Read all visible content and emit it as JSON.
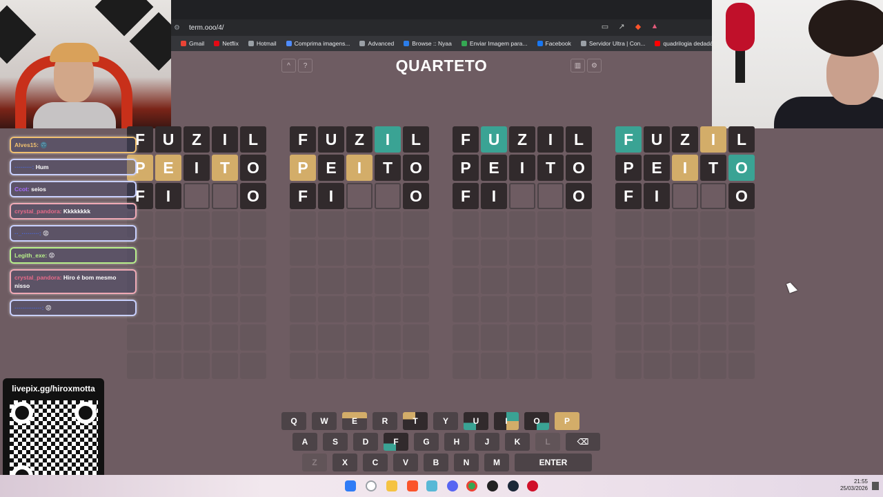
{
  "browser": {
    "url": "term.ooo/4/",
    "bookmarks": [
      "Gmail",
      "Netflix",
      "Hotmail",
      "Comprima imagens...",
      "Advanced",
      "Browse :: Nyaa",
      "Enviar Imagem para...",
      "Facebook",
      "Servidor Ultra | Con...",
      "quadrilogia dedadá..."
    ],
    "bookmark_colors": [
      "#ea4335",
      "#e50914",
      "#9aa0a6",
      "#4f8cff",
      "#9aa0a6",
      "#2b7de9",
      "#34a853",
      "#1877f2",
      "#9aa0a6",
      "#ff0000"
    ]
  },
  "game": {
    "title": "QUARTETO",
    "left_buttons": [
      "^",
      "?"
    ],
    "right_buttons": [
      "stats-icon",
      "gear-icon"
    ],
    "boards": [
      [
        [
          [
            "F",
            "filled"
          ],
          [
            "U",
            "filled"
          ],
          [
            "Z",
            "filled"
          ],
          [
            "I",
            "filled"
          ],
          [
            "L",
            "filled"
          ]
        ],
        [
          [
            "P",
            "present"
          ],
          [
            "E",
            "present"
          ],
          [
            "I",
            "filled"
          ],
          [
            "T",
            "present"
          ],
          [
            "O",
            "filled"
          ]
        ],
        [
          [
            "F",
            "filled"
          ],
          [
            "I",
            "filled"
          ],
          [
            "",
            "empty-cur"
          ],
          [
            "",
            "empty-cur"
          ],
          [
            "O",
            "filled"
          ]
        ]
      ],
      [
        [
          [
            "F",
            "filled"
          ],
          [
            "U",
            "filled"
          ],
          [
            "Z",
            "filled"
          ],
          [
            "I",
            "correct"
          ],
          [
            "L",
            "filled"
          ]
        ],
        [
          [
            "P",
            "present"
          ],
          [
            "E",
            "filled"
          ],
          [
            "I",
            "present"
          ],
          [
            "T",
            "filled"
          ],
          [
            "O",
            "filled"
          ]
        ],
        [
          [
            "F",
            "filled"
          ],
          [
            "I",
            "filled"
          ],
          [
            "",
            "empty-cur"
          ],
          [
            "",
            "empty-cur"
          ],
          [
            "O",
            "filled"
          ]
        ]
      ],
      [
        [
          [
            "F",
            "filled"
          ],
          [
            "U",
            "correct"
          ],
          [
            "Z",
            "filled"
          ],
          [
            "I",
            "filled"
          ],
          [
            "L",
            "filled"
          ]
        ],
        [
          [
            "P",
            "filled"
          ],
          [
            "E",
            "filled"
          ],
          [
            "I",
            "filled"
          ],
          [
            "T",
            "filled"
          ],
          [
            "O",
            "filled"
          ]
        ],
        [
          [
            "F",
            "filled"
          ],
          [
            "I",
            "filled"
          ],
          [
            "",
            "empty-cur"
          ],
          [
            "",
            "empty-cur"
          ],
          [
            "O",
            "filled"
          ]
        ]
      ],
      [
        [
          [
            "F",
            "correct"
          ],
          [
            "U",
            "filled"
          ],
          [
            "Z",
            "filled"
          ],
          [
            "I",
            "present"
          ],
          [
            "L",
            "filled"
          ]
        ],
        [
          [
            "P",
            "filled"
          ],
          [
            "E",
            "filled"
          ],
          [
            "I",
            "present"
          ],
          [
            "T",
            "filled"
          ],
          [
            "O",
            "correct"
          ]
        ],
        [
          [
            "F",
            "filled"
          ],
          [
            "I",
            "filled"
          ],
          [
            "",
            "empty-cur"
          ],
          [
            "",
            "empty-cur"
          ],
          [
            "O",
            "filled"
          ]
        ]
      ]
    ],
    "total_rows": 9,
    "keyboard": {
      "row1": [
        [
          "Q",
          ""
        ],
        [
          "W",
          ""
        ],
        [
          "E",
          "present"
        ],
        [
          "R",
          ""
        ],
        [
          "T",
          "present-dark"
        ],
        [
          "Y",
          ""
        ],
        [
          "U",
          "correct-dark"
        ],
        [
          "I",
          "mix"
        ],
        [
          "O",
          "correct-dark"
        ],
        [
          "P",
          "present"
        ]
      ],
      "row2": [
        [
          "A",
          ""
        ],
        [
          "S",
          ""
        ],
        [
          "D",
          ""
        ],
        [
          "F",
          "correct-dark"
        ],
        [
          "G",
          ""
        ],
        [
          "H",
          ""
        ],
        [
          "J",
          ""
        ],
        [
          "K",
          ""
        ],
        [
          "L",
          "out"
        ],
        [
          "⌫",
          "backspace"
        ]
      ],
      "row3": [
        [
          "Z",
          "out"
        ],
        [
          "X",
          ""
        ],
        [
          "C",
          ""
        ],
        [
          "V",
          ""
        ],
        [
          "B",
          ""
        ],
        [
          "N",
          ""
        ],
        [
          "M",
          ""
        ],
        [
          "ENTER",
          "enter"
        ]
      ]
    }
  },
  "chat": [
    {
      "user": "Alves15:",
      "text": "🌚",
      "style": "orange",
      "user_color": "#f0c070"
    },
    {
      "user": "·········:",
      "text": "Hum",
      "style": "blue",
      "user_color": "#4a6adf"
    },
    {
      "user": "Ccot:",
      "text": "seios",
      "style": "blue",
      "user_color": "#a86bff"
    },
    {
      "user": "crystal_pandora:",
      "text": "Kkkkkkkk",
      "style": "pink",
      "user_color": "#e86b8a"
    },
    {
      "user": "··_·········:",
      "text": "😡",
      "style": "blue",
      "user_color": "#4a6adf"
    },
    {
      "user": "Legith_exe:",
      "text": "😡",
      "style": "green",
      "user_color": "#b8f08a"
    },
    {
      "user": "crystal_pandora:",
      "text": "Hiro é bom mesmo nisso",
      "style": "pink",
      "user_color": "#e86b8a"
    },
    {
      "user": "··············:",
      "text": "😡",
      "style": "blue",
      "user_color": "#4a6adf"
    }
  ],
  "qr": {
    "label": "livepix.gg/hiroxmotta"
  },
  "clock": {
    "time": "21:55",
    "date": "25/03/2026"
  },
  "colors": {
    "present": "#d3ad69",
    "correct": "#3aa394",
    "tile": "#312a2c",
    "bg": "#6e5c62"
  }
}
